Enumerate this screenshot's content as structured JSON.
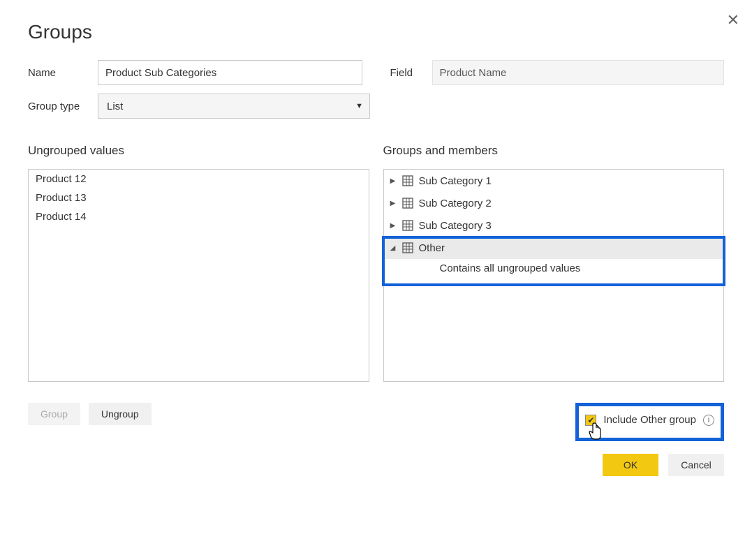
{
  "dialog": {
    "title": "Groups",
    "name_label": "Name",
    "name_value": "Product Sub Categories",
    "field_label": "Field",
    "field_value": "Product Name",
    "group_type_label": "Group type",
    "group_type_value": "List"
  },
  "ungrouped": {
    "heading": "Ungrouped values",
    "items": [
      "Product 12",
      "Product 13",
      "Product 14"
    ]
  },
  "groups": {
    "heading": "Groups and members",
    "items": [
      {
        "label": "Sub Category 1",
        "expanded": false
      },
      {
        "label": "Sub Category 2",
        "expanded": false
      },
      {
        "label": "Sub Category 3",
        "expanded": false
      },
      {
        "label": "Other",
        "expanded": true,
        "child": "Contains all ungrouped values"
      }
    ]
  },
  "actions": {
    "group": "Group",
    "ungroup": "Ungroup",
    "include_other": "Include Other group",
    "include_other_checked": true,
    "ok": "OK",
    "cancel": "Cancel"
  }
}
